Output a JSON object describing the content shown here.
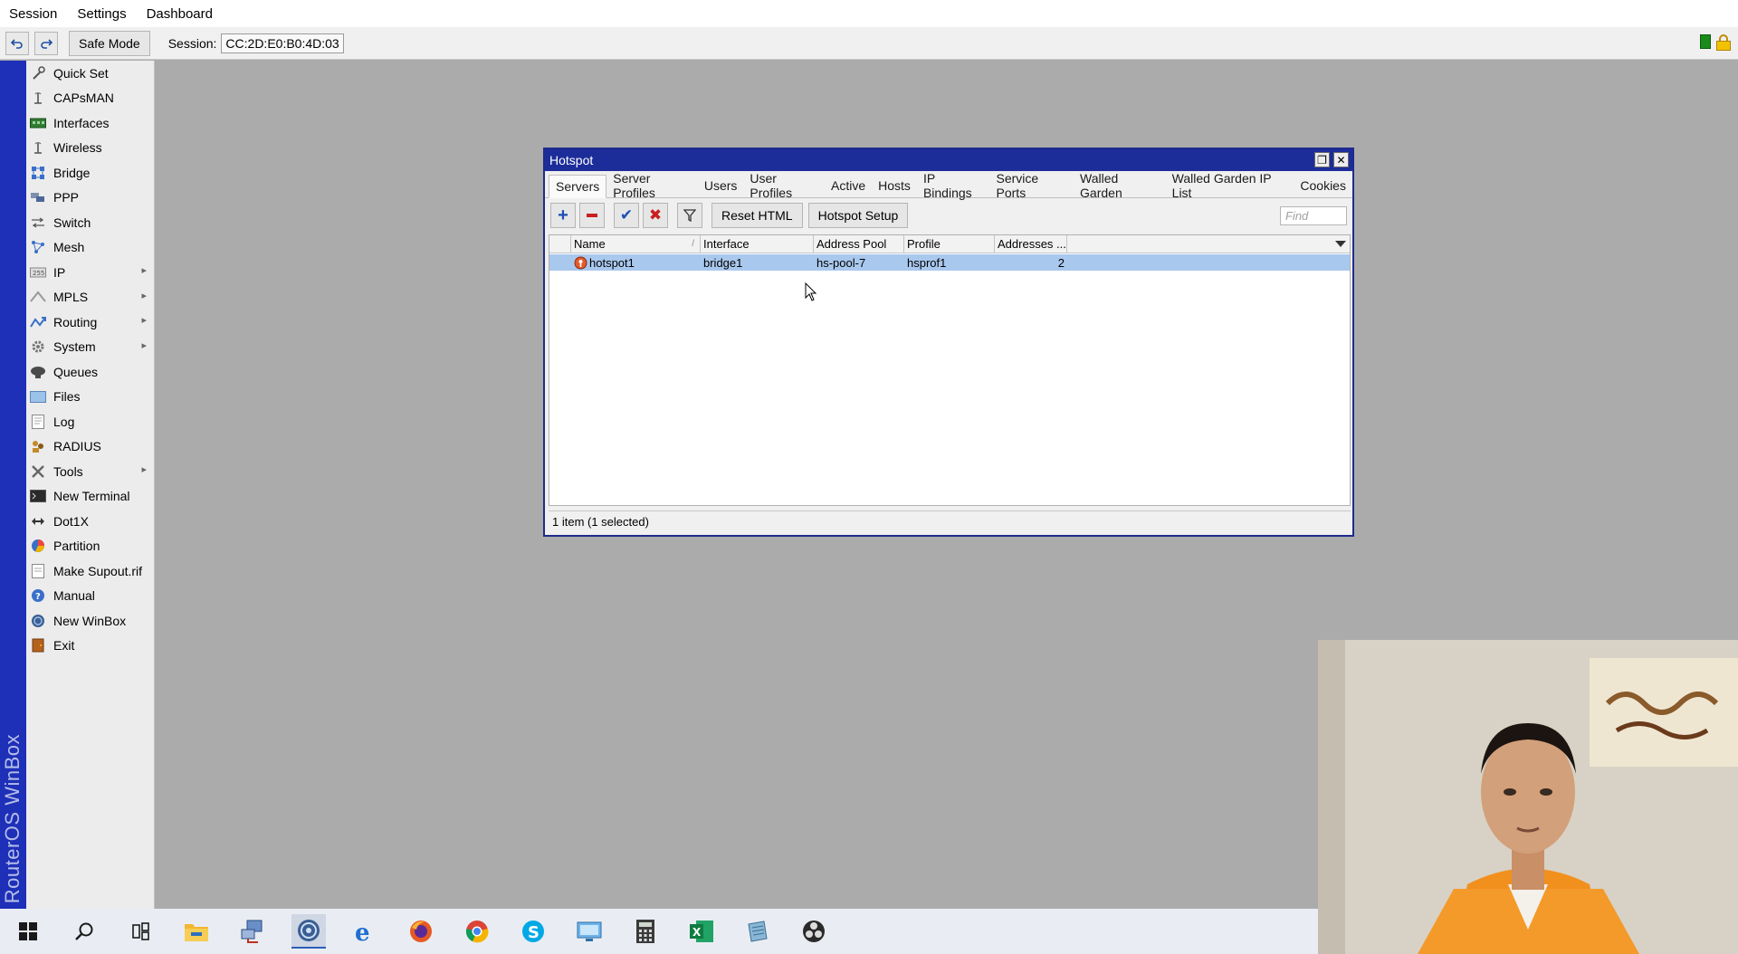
{
  "menubar": {
    "items": [
      "Session",
      "Settings",
      "Dashboard"
    ]
  },
  "toolbar": {
    "safe_mode_label": "Safe Mode",
    "session_label": "Session:",
    "session_value": "CC:2D:E0:B0:4D:03"
  },
  "sidebar": {
    "brand_text": "RouterOS WinBox",
    "items": [
      {
        "label": "Quick Set",
        "icon": "quick-set-icon"
      },
      {
        "label": "CAPsMAN",
        "icon": "capsman-icon"
      },
      {
        "label": "Interfaces",
        "icon": "interfaces-icon"
      },
      {
        "label": "Wireless",
        "icon": "wireless-icon"
      },
      {
        "label": "Bridge",
        "icon": "bridge-icon"
      },
      {
        "label": "PPP",
        "icon": "ppp-icon"
      },
      {
        "label": "Switch",
        "icon": "switch-icon"
      },
      {
        "label": "Mesh",
        "icon": "mesh-icon"
      },
      {
        "label": "IP",
        "icon": "ip-icon",
        "submenu": true
      },
      {
        "label": "MPLS",
        "icon": "mpls-icon",
        "submenu": true
      },
      {
        "label": "Routing",
        "icon": "routing-icon",
        "submenu": true
      },
      {
        "label": "System",
        "icon": "system-icon",
        "submenu": true
      },
      {
        "label": "Queues",
        "icon": "queues-icon"
      },
      {
        "label": "Files",
        "icon": "files-icon"
      },
      {
        "label": "Log",
        "icon": "log-icon"
      },
      {
        "label": "RADIUS",
        "icon": "radius-icon"
      },
      {
        "label": "Tools",
        "icon": "tools-icon",
        "submenu": true
      },
      {
        "label": "New Terminal",
        "icon": "terminal-icon"
      },
      {
        "label": "Dot1X",
        "icon": "dot1x-icon"
      },
      {
        "label": "Partition",
        "icon": "partition-icon"
      },
      {
        "label": "Make Supout.rif",
        "icon": "supout-icon"
      },
      {
        "label": "Manual",
        "icon": "manual-icon"
      },
      {
        "label": "New WinBox",
        "icon": "winbox-icon"
      },
      {
        "label": "Exit",
        "icon": "exit-icon"
      }
    ]
  },
  "hotspot_window": {
    "title": "Hotspot",
    "tabs": [
      "Servers",
      "Server Profiles",
      "Users",
      "User Profiles",
      "Active",
      "Hosts",
      "IP Bindings",
      "Service Ports",
      "Walled Garden",
      "Walled Garden IP List",
      "Cookies"
    ],
    "active_tab": "Servers",
    "buttons": {
      "reset_html": "Reset HTML",
      "hotspot_setup": "Hotspot Setup"
    },
    "find_placeholder": "Find",
    "columns": {
      "name": "Name",
      "interface": "Interface",
      "address_pool": "Address Pool",
      "profile": "Profile",
      "addresses": "Addresses ..."
    },
    "rows": [
      {
        "name": "hotspot1",
        "interface": "bridge1",
        "address_pool": "hs-pool-7",
        "profile": "hsprof1",
        "addresses": "2"
      }
    ],
    "status": "1 item (1 selected)"
  },
  "colors": {
    "winbox_blue": "#1e2fb8",
    "title_blue": "#1c2d9a",
    "selected_row": "#a9c8ee",
    "desktop_bg": "#ababab"
  },
  "taskbar": {
    "icons": [
      "windows-start-icon",
      "search-icon",
      "task-view-icon",
      "file-explorer-icon",
      "network-app-icon",
      "winbox-icon",
      "edge-icon",
      "firefox-icon",
      "chrome-icon",
      "skype-icon",
      "remote-desktop-icon",
      "calculator-icon",
      "excel-icon",
      "notes-app-icon",
      "obs-icon"
    ]
  }
}
